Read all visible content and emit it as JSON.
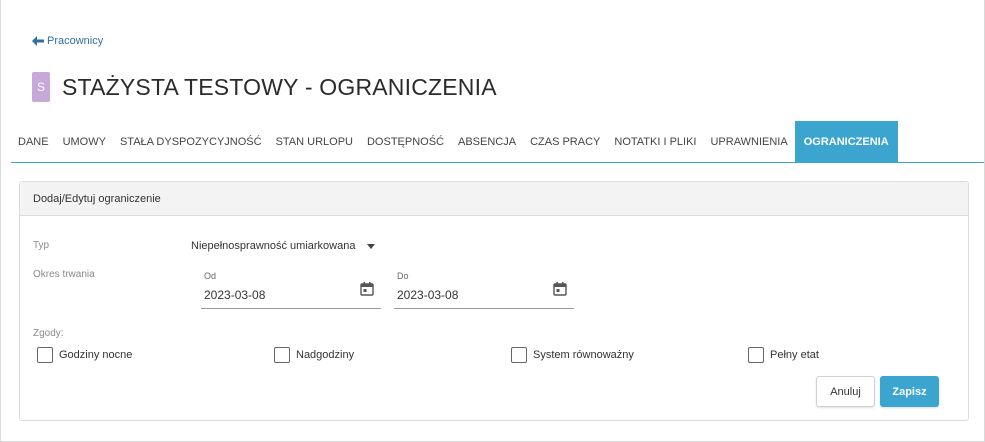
{
  "nav": {
    "back_label": "Pracownicy"
  },
  "header": {
    "avatar_letter": "S",
    "title": "STAŻYSTA TESTOWY - OGRANICZENIA"
  },
  "tabs": [
    {
      "label": "DANE"
    },
    {
      "label": "UMOWY"
    },
    {
      "label": "STAŁA DYSPOZYCYJNOŚĆ"
    },
    {
      "label": "STAN URLOPU"
    },
    {
      "label": "DOSTĘPNOŚĆ"
    },
    {
      "label": "ABSENCJA"
    },
    {
      "label": "CZAS PRACY"
    },
    {
      "label": "NOTATKI I PLIKI"
    },
    {
      "label": "UPRAWNIENIA"
    },
    {
      "label": "OGRANICZENIA",
      "active": true
    }
  ],
  "form": {
    "panel_title": "Dodaj/Edytuj ograniczenie",
    "type_label": "Typ",
    "type_value": "Niepełnosprawność umiarkowana",
    "duration_label": "Okres trwania",
    "from_label": "Od",
    "from_value": "2023-03-08",
    "to_label": "Do",
    "to_value": "2023-03-08",
    "consents_label": "Zgody:",
    "consents": [
      {
        "label": "Godziny nocne",
        "checked": false
      },
      {
        "label": "Nadgodziny",
        "checked": false
      },
      {
        "label": "System równoważny",
        "checked": false
      },
      {
        "label": "Pełny etat",
        "checked": false
      }
    ],
    "cancel_label": "Anuluj",
    "save_label": "Zapisz"
  },
  "colors": {
    "accent": "#3ba5cf",
    "link": "#2f6fa3",
    "avatar": "#c7a9d9"
  },
  "icons": {
    "back": "arrow-left-icon",
    "calendar": "calendar-icon",
    "dropdown": "caret-down-icon"
  }
}
